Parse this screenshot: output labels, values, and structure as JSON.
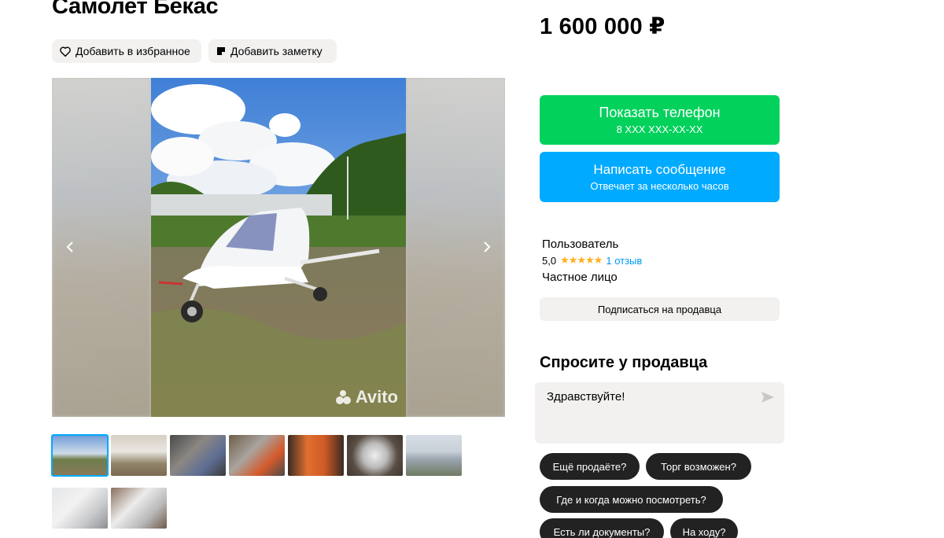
{
  "listing": {
    "title": "Самолет Бекас",
    "price": "1 600 000 ₽",
    "favorite_label": "Добавить в избранное",
    "note_label": "Добавить заметку"
  },
  "gallery": {
    "watermark": "Avito",
    "thumb_count": 9,
    "active_thumb": 1
  },
  "contact": {
    "phone_label": "Показать телефон",
    "phone_sub": "8 XXX XXX-XX-XX",
    "message_label": "Написать сообщение",
    "message_sub": "Отвечает за несколько часов"
  },
  "seller": {
    "name": "Пользователь",
    "rating": "5,0",
    "stars": "★★★★★",
    "reviews": "1 отзыв",
    "type": "Частное лицо",
    "subscribe_label": "Подписаться на продавца"
  },
  "ask": {
    "title": "Спросите у продавца",
    "message_value": "Здравствуйте!",
    "chips": [
      "Ещё продаёте?",
      "Торг возможен?",
      "Где и когда можно посмотреть?",
      "Есть ли документы?",
      "На ходу?"
    ]
  },
  "colors": {
    "green_button": "#02d15c",
    "blue_button": "#00aaff",
    "star": "#ffb021",
    "link": "#0099ee",
    "chip": "#222222"
  }
}
